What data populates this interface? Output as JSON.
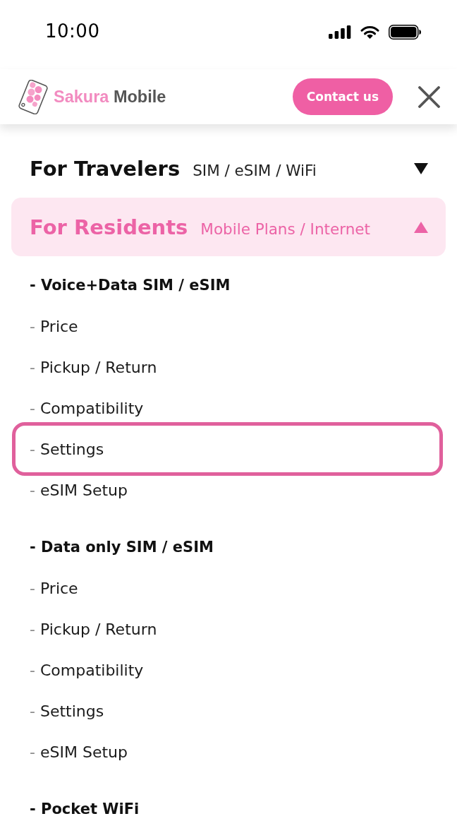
{
  "status_bar": {
    "time": "10:00"
  },
  "header": {
    "brand": [
      "Sakura",
      "Mobile"
    ],
    "contact_button": "Contact us"
  },
  "menu": [
    {
      "title": "For Travelers",
      "subtitle": "SIM / eSIM / WiFi",
      "expanded": false
    },
    {
      "title": "For Residents",
      "subtitle": "Mobile Plans / Internet",
      "expanded": true,
      "groups": [
        {
          "heading": "- Voice+Data SIM / eSIM",
          "items": [
            {
              "bullet": "-",
              "label": "Price",
              "highlighted": false
            },
            {
              "bullet": "-",
              "label": "Pickup / Return",
              "highlighted": false
            },
            {
              "bullet": "-",
              "label": "Compatibility",
              "highlighted": false
            },
            {
              "bullet": "-",
              "label": "Settings",
              "highlighted": true
            },
            {
              "bullet": "-",
              "label": "eSIM Setup",
              "highlighted": false
            }
          ]
        },
        {
          "heading": "- Data only SIM / eSIM",
          "items": [
            {
              "bullet": "-",
              "label": "Price",
              "highlighted": false
            },
            {
              "bullet": "-",
              "label": "Pickup / Return",
              "highlighted": false
            },
            {
              "bullet": "-",
              "label": "Compatibility",
              "highlighted": false
            },
            {
              "bullet": "-",
              "label": "Settings",
              "highlighted": false
            },
            {
              "bullet": "-",
              "label": "eSIM Setup",
              "highlighted": false
            }
          ]
        },
        {
          "heading": "- Pocket WiFi"
        }
      ]
    }
  ]
}
